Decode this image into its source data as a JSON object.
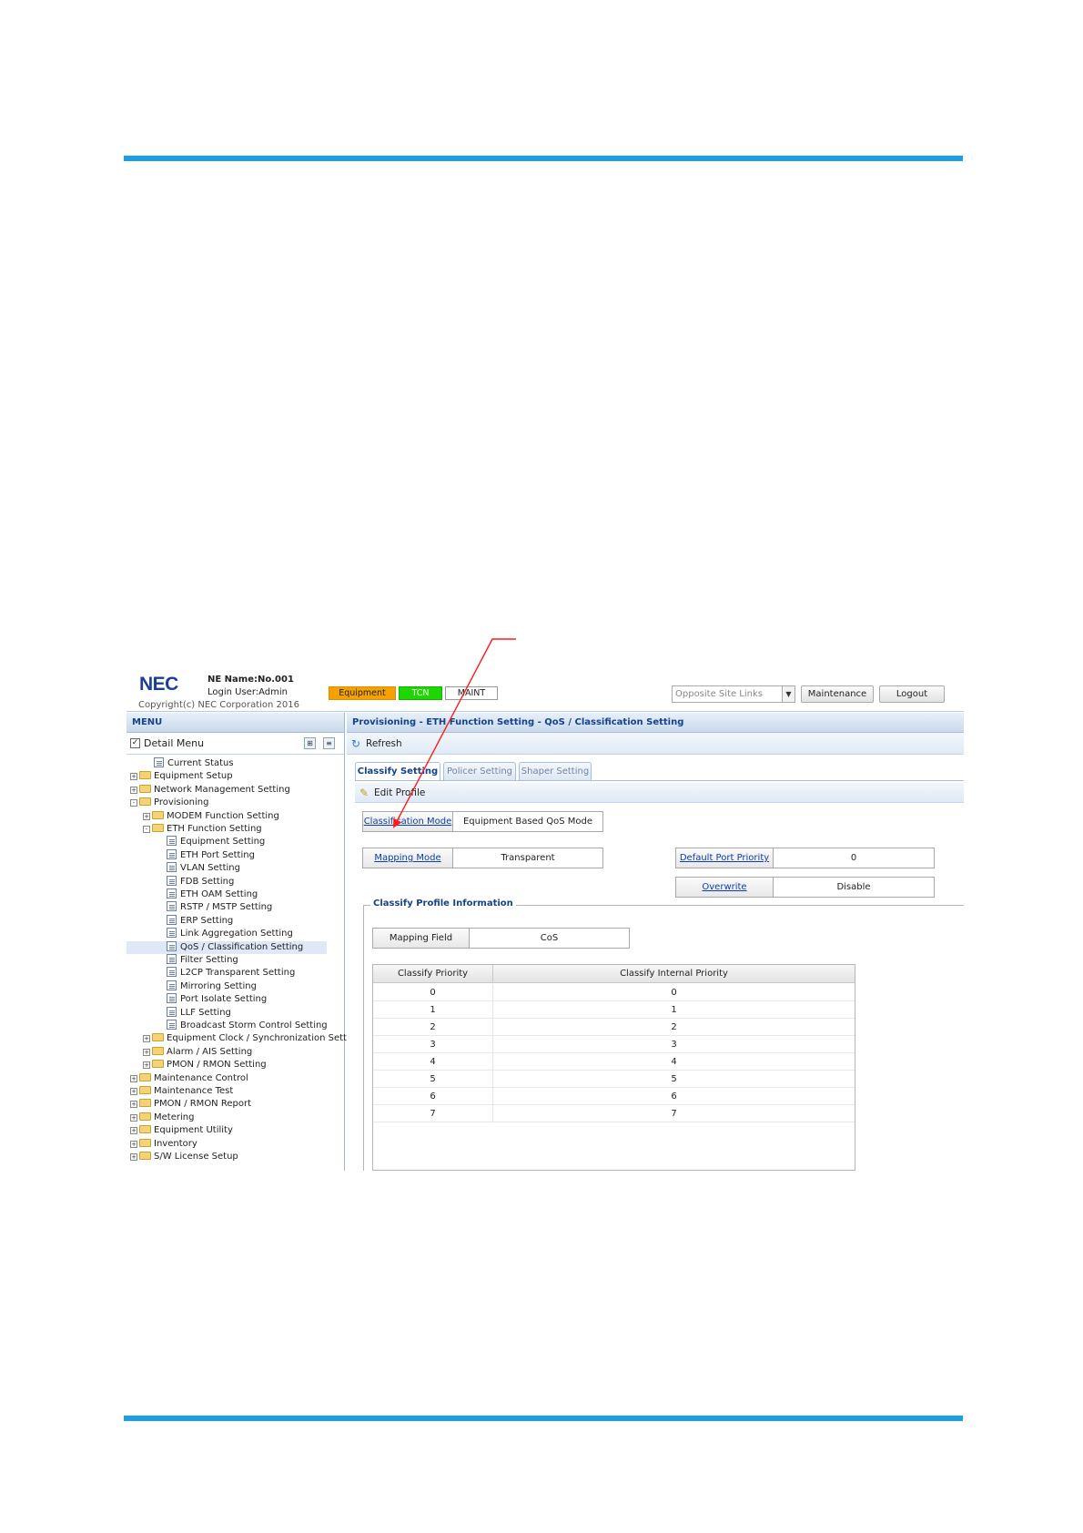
{
  "header": {
    "logo": "NEC",
    "ne_name": "NE Name:No.001",
    "login_user": "Login User:Admin",
    "copyright": "Copyright(c) NEC Corporation 2016",
    "status": {
      "equipment": "Equipment",
      "tcn": "TCN",
      "maint": "MAINT"
    },
    "site_links": "Opposite Site Links",
    "maintenance_label": "Maintenance",
    "logout_label": "Logout"
  },
  "colors": {
    "accent_rule": "#1a9ee6",
    "equipment": "#f5a200",
    "tcn": "#1ed600",
    "link": "#0b3ea8",
    "arrow": "#ff1a1a"
  },
  "sidebar": {
    "title": "MENU",
    "detail_menu": "Detail Menu",
    "tree": [
      {
        "label": "Current Status",
        "icon": "page-icon",
        "level": 1,
        "toggle": ""
      },
      {
        "label": "Equipment Setup",
        "icon": "folder-icon",
        "level": 0,
        "toggle": "+"
      },
      {
        "label": "Network Management Setting",
        "icon": "folder-icon",
        "level": 0,
        "toggle": "+"
      },
      {
        "label": "Provisioning",
        "icon": "folder-icon",
        "level": 0,
        "toggle": "-"
      },
      {
        "label": "MODEM Function Setting",
        "icon": "folder-icon",
        "level": 1,
        "toggle": "+"
      },
      {
        "label": "ETH Function Setting",
        "icon": "folder-icon",
        "level": 1,
        "toggle": "-"
      },
      {
        "label": "Equipment Setting",
        "icon": "page-icon",
        "level": 2,
        "toggle": ""
      },
      {
        "label": "ETH Port Setting",
        "icon": "page-icon",
        "level": 2,
        "toggle": ""
      },
      {
        "label": "VLAN Setting",
        "icon": "page-icon",
        "level": 2,
        "toggle": ""
      },
      {
        "label": "FDB Setting",
        "icon": "page-icon",
        "level": 2,
        "toggle": ""
      },
      {
        "label": "ETH OAM Setting",
        "icon": "page-icon",
        "level": 2,
        "toggle": ""
      },
      {
        "label": "RSTP / MSTP Setting",
        "icon": "page-icon",
        "level": 2,
        "toggle": ""
      },
      {
        "label": "ERP Setting",
        "icon": "page-icon",
        "level": 2,
        "toggle": ""
      },
      {
        "label": "Link Aggregation Setting",
        "icon": "page-icon",
        "level": 2,
        "toggle": ""
      },
      {
        "label": "QoS / Classification Setting",
        "icon": "page-icon",
        "level": 2,
        "toggle": "",
        "selected": true
      },
      {
        "label": "Filter Setting",
        "icon": "page-icon",
        "level": 2,
        "toggle": ""
      },
      {
        "label": "L2CP Transparent Setting",
        "icon": "page-icon",
        "level": 2,
        "toggle": ""
      },
      {
        "label": "Mirroring Setting",
        "icon": "page-icon",
        "level": 2,
        "toggle": ""
      },
      {
        "label": "Port Isolate Setting",
        "icon": "page-icon",
        "level": 2,
        "toggle": ""
      },
      {
        "label": "LLF Setting",
        "icon": "page-icon",
        "level": 2,
        "toggle": ""
      },
      {
        "label": "Broadcast Storm Control Setting",
        "icon": "page-icon",
        "level": 2,
        "toggle": ""
      },
      {
        "label": "Equipment Clock / Synchronization Setting",
        "icon": "folder-icon",
        "level": 1,
        "toggle": "+"
      },
      {
        "label": "Alarm / AIS Setting",
        "icon": "folder-icon",
        "level": 1,
        "toggle": "+"
      },
      {
        "label": "PMON / RMON Setting",
        "icon": "folder-icon",
        "level": 1,
        "toggle": "+"
      },
      {
        "label": "Maintenance Control",
        "icon": "folder-icon",
        "level": 0,
        "toggle": "+"
      },
      {
        "label": "Maintenance Test",
        "icon": "folder-icon",
        "level": 0,
        "toggle": "+"
      },
      {
        "label": "PMON / RMON Report",
        "icon": "folder-icon",
        "level": 0,
        "toggle": "+"
      },
      {
        "label": "Metering",
        "icon": "folder-icon",
        "level": 0,
        "toggle": "+"
      },
      {
        "label": "Equipment Utility",
        "icon": "folder-icon",
        "level": 0,
        "toggle": "+"
      },
      {
        "label": "Inventory",
        "icon": "folder-icon",
        "level": 0,
        "toggle": "+"
      },
      {
        "label": "S/W License Setup",
        "icon": "folder-icon",
        "level": 0,
        "toggle": "+"
      }
    ]
  },
  "main": {
    "breadcrumb": "Provisioning - ETH Function Setting - QoS / Classification Setting",
    "refresh_label": "Refresh",
    "tabs": [
      {
        "label": "Classify Setting",
        "active": true
      },
      {
        "label": "Policer Setting",
        "active": false
      },
      {
        "label": "Shaper Setting",
        "active": false
      }
    ],
    "edit_profile_label": "Edit Profile",
    "fields": {
      "classification_mode": {
        "label": "Classification Mode",
        "value": "Equipment Based QoS Mode"
      },
      "mapping_mode": {
        "label": "Mapping Mode",
        "value": "Transparent"
      },
      "default_port_priority": {
        "label": "Default Port Priority",
        "value": "0"
      },
      "overwrite": {
        "label": "Overwrite",
        "value": "Disable"
      }
    },
    "profile_section": {
      "title": "Classify Profile Information",
      "mapping_field": {
        "label": "Mapping Field",
        "value": "CoS"
      },
      "columns": [
        "Classify Priority",
        "Classify Internal Priority"
      ],
      "rows": [
        [
          "0",
          "0"
        ],
        [
          "1",
          "1"
        ],
        [
          "2",
          "2"
        ],
        [
          "3",
          "3"
        ],
        [
          "4",
          "4"
        ],
        [
          "5",
          "5"
        ],
        [
          "6",
          "6"
        ],
        [
          "7",
          "7"
        ]
      ]
    }
  }
}
